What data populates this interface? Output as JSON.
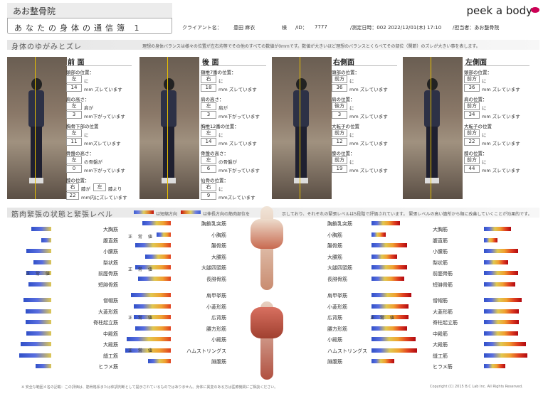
{
  "header": {
    "clinic": "あお整骨院",
    "title": "あなたの身体の通信簿 1",
    "client_label": "クライアント名：",
    "client_name": "豊田 麻衣",
    "honorific": "様",
    "id_label": "/ID：",
    "id": "7777",
    "date": "/測定日時：002 2022/12/01(木) 17:10",
    "staff": "/担当者：あお整骨院",
    "logo": "peek a body"
  },
  "posture": {
    "title": "身体のゆがみとズレ",
    "note": "理想の身体バランスは様々の位置が左右均等でその他のすべての数値が0mmです。数値が大きいほど理想のバランスとくらべてその部位（関節）のズレが大きい事を表します。",
    "front": {
      "title": "前 面",
      "items": [
        [
          "頭部の位置：",
          "左",
          "に",
          "14",
          "mm ズレています"
        ],
        [
          "肩の高さ：",
          "左",
          "肩が",
          "3",
          "mm下がっています"
        ],
        [
          "胸骨下部の位置",
          "左",
          "に",
          "11",
          "mmズレています"
        ],
        [
          "骨盤の高さ：",
          "左",
          "の骨盤が",
          "0",
          "mm下がっています"
        ]
      ],
      "knee": {
        "label": "膝の位置：",
        "a": "右",
        "b": "膝が",
        "c": "左",
        "d": "膝より",
        "v": "22",
        "u": "mm内にズレています"
      }
    },
    "back": {
      "title": "後 面",
      "items": [
        [
          "頚椎7番の位置：",
          "右",
          "に",
          "18",
          "mm ズレています"
        ],
        [
          "肩の高さ：",
          "左",
          "肩が",
          "3",
          "mm下がっています"
        ],
        [
          "胸椎12番の位置：",
          "左",
          "に",
          "14",
          "mm ズレています"
        ],
        [
          "骨盤の高さ：",
          "左",
          "の骨盤が",
          "6",
          "mm下がっています"
        ],
        [
          "仙骨の位置：",
          "右",
          "に",
          "9",
          "mmズレています"
        ]
      ]
    },
    "right": {
      "title": "右側面",
      "items": [
        [
          "頭部の位置：",
          "前方",
          "に",
          "36",
          "mm ズレています"
        ],
        [
          "肩の位置：",
          "後方",
          "に",
          "3",
          "mm ズレています"
        ],
        [
          "大転子の位置",
          "前方",
          "に",
          "12",
          "mm ズレています"
        ],
        [
          "膝の位置：",
          "前方",
          "に",
          "19",
          "mm ズレています"
        ]
      ]
    },
    "left": {
      "title": "左側面",
      "items": [
        [
          "頭部の位置：",
          "前方",
          "に",
          "36",
          "mm ズレています"
        ],
        [
          "肩の位置：",
          "前方",
          "に",
          "34",
          "mm ズレています"
        ],
        [
          "大転子の位置",
          "前方",
          "に",
          "22",
          "mm ズレています"
        ],
        [
          "膝の位置：",
          "前方",
          "に",
          "44",
          "mm ズレています"
        ]
      ]
    }
  },
  "muscle": {
    "title": "筋肉緊張の状態と緊張レベル",
    "legend1": "は短縮方向",
    "legend2": "は伸長方向の筋肉部位を",
    "note": "示しており、それぞれの緊張レベルは5段階で評価されています。 緊張レベルの高い箇所から順に改善していくことが効果的です。",
    "upper_left": [
      "大胸筋",
      "腹直筋",
      "小腰筋",
      "梨状筋",
      "前脛骨筋",
      "短腓骨筋"
    ],
    "upper_mid": [
      "胸鎖乳突筋",
      "小胸筋",
      "腸骨筋",
      "大腰筋",
      "大腿四頭筋",
      "長腓骨筋"
    ],
    "upper_right_mid": [
      "胸鎖乳突筋",
      "小胸筋",
      "腸骨筋",
      "大腰筋",
      "大腿四頭筋",
      "長腓骨筋"
    ],
    "upper_right": [
      "大胸筋",
      "腹直筋",
      "小腰筋",
      "梨状筋",
      "前脛骨筋",
      "短腓骨筋"
    ],
    "lower_left": [
      "僧帽筋",
      "大菱形筋",
      "脊柱起立筋",
      "中殿筋",
      "大殿筋",
      "縫工筋",
      "ヒラメ筋"
    ],
    "lower_mid": [
      "肩甲挙筋",
      "小菱形筋",
      "広背筋",
      "腰方形筋",
      "小殿筋",
      "ハムストリングス",
      "腓腹筋"
    ],
    "lower_right_mid": [
      "肩甲挙筋",
      "小菱形筋",
      "広背筋",
      "腰方形筋",
      "小殿筋",
      "ハムストリングス",
      "腓腹筋"
    ],
    "lower_right": [
      "僧帽筋",
      "大菱形筋",
      "脊柱起立筋",
      "中殿筋",
      "大殿筋",
      "縫工筋",
      "ヒラメ筋"
    ],
    "normal": "正 常 値"
  },
  "footer": {
    "note": "※ 安全な範囲４名の記載：この評価は、筋骨格系または体調判断として提示されているものではありません。身体に異変のある方は医療機関にご相談ください。",
    "copyright": "Copyright (C) 2015 B.C Lab Inc. All Rights Reserved."
  }
}
